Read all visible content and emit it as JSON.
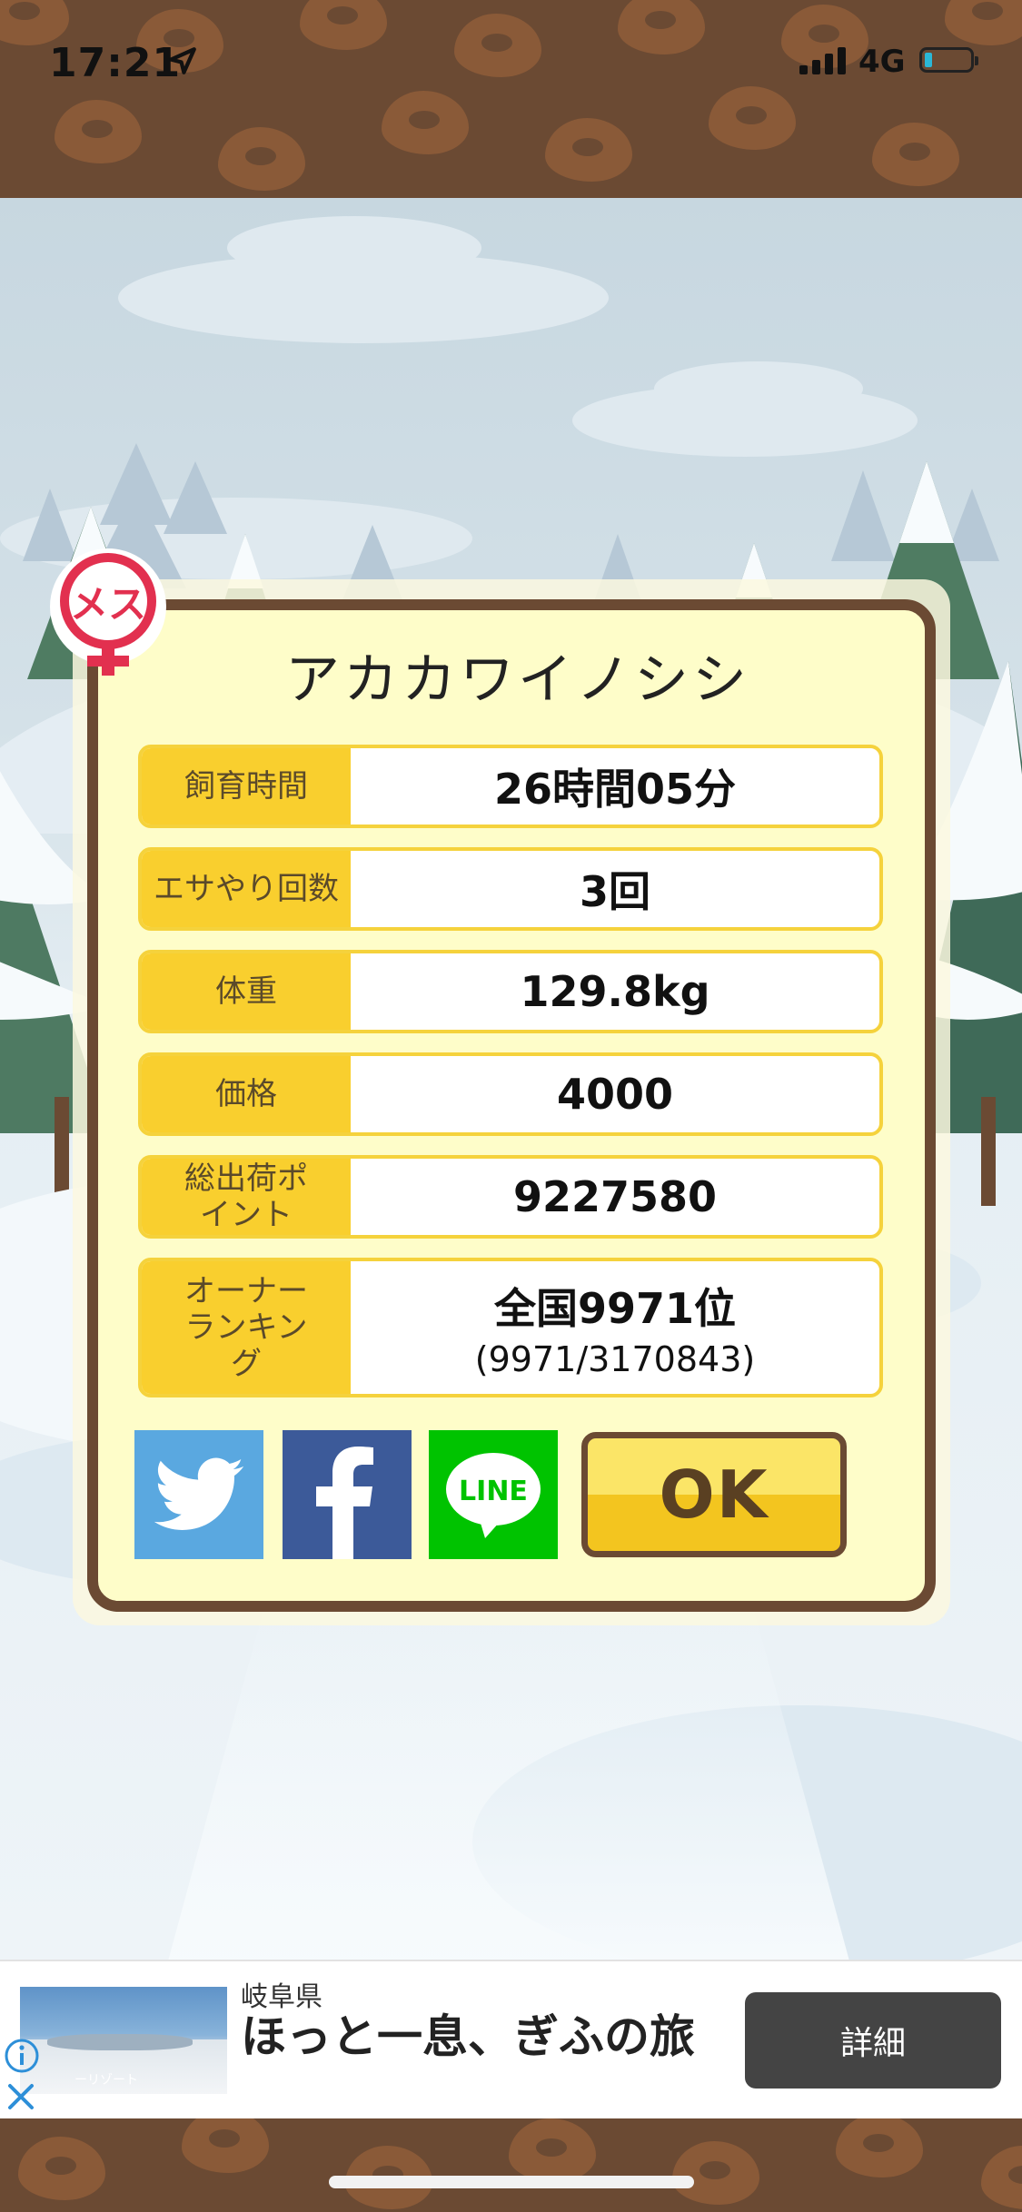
{
  "status_bar": {
    "time": "17:21",
    "network": "4G"
  },
  "pig": {
    "name": "アカカワイノシシ",
    "gender_badge": "メス"
  },
  "stats": [
    {
      "label": "飼育時間",
      "value": "26時間05分"
    },
    {
      "label": "エサやり回数",
      "value": "3回"
    },
    {
      "label": "体重",
      "value": "129.8kg"
    },
    {
      "label": "価格",
      "value": "4000"
    },
    {
      "label": "総出荷ポイント",
      "value": "9227580"
    },
    {
      "label": "オーナーランキング",
      "value": "全国9971位",
      "sub": "(9971/3170843)"
    }
  ],
  "share": {
    "twitter_icon": "twitter-bird",
    "facebook_icon": "facebook-f",
    "line_text": "LINE"
  },
  "ok_button": {
    "label": "OK"
  },
  "ad": {
    "image_caption": "ーリゾート",
    "region": "岐阜県",
    "headline": "ほっと一息、ぎふの旅",
    "cta": "詳細"
  },
  "colors": {
    "brown": "#6b4a33",
    "panel": "#fefdc9",
    "label_yellow": "#f9cf2e",
    "ok_yellow": "#fbe567"
  }
}
